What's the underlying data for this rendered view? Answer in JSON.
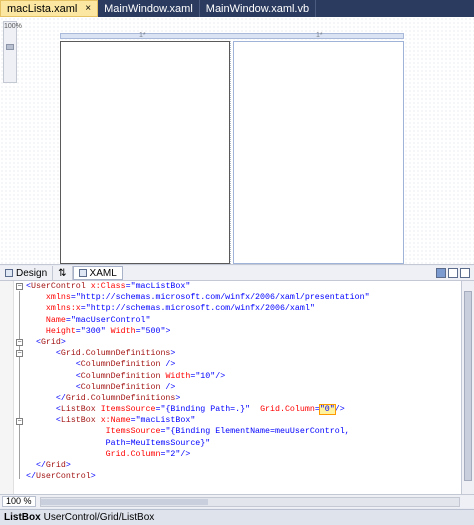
{
  "tabs": [
    {
      "label": "macLista.xaml",
      "active": true,
      "close": "×"
    },
    {
      "label": "MainWindow.xaml",
      "active": false
    },
    {
      "label": "MainWindow.xaml.vb",
      "active": false
    }
  ],
  "design": {
    "zoom_rail_label": "100%",
    "col_markers": {
      "top_left": "1*",
      "top_right": "1*"
    }
  },
  "split_tabs": {
    "design": "Design",
    "swap": "⇅",
    "xaml": "XAML"
  },
  "code_lines": [
    [
      "<",
      "UserControl",
      " ",
      "x:Class",
      "=",
      "\"macListBox\""
    ],
    [
      "    ",
      "xmlns",
      "=",
      "\"http://schemas.microsoft.com/winfx/2006/xaml/presentation\""
    ],
    [
      "    ",
      "xmlns:x",
      "=",
      "\"http://schemas.microsoft.com/winfx/2006/xaml\""
    ],
    [
      "    ",
      "Name",
      "=",
      "\"macUserControl\""
    ],
    [
      "    ",
      "Height",
      "=",
      "\"300\"",
      " ",
      "Width",
      "=",
      "\"500\"",
      ">"
    ],
    [
      "  <",
      "Grid",
      ">"
    ],
    [
      "      <",
      "Grid.ColumnDefinitions",
      ">"
    ],
    [
      "          <",
      "ColumnDefinition",
      " />"
    ],
    [
      "          <",
      "ColumnDefinition",
      " ",
      "Width",
      "=",
      "\"10\"",
      "/>"
    ],
    [
      "          <",
      "ColumnDefinition",
      " />"
    ],
    [
      "      </",
      "Grid.ColumnDefinitions",
      ">"
    ],
    [
      "      <",
      "ListBox",
      " ",
      "ItemsSource",
      "=",
      "\"{Binding Path=.}\"",
      "  ",
      "Grid.Column",
      "=",
      "\"0\"",
      "/>"
    ],
    [
      "      <",
      "ListBox",
      " ",
      "x:Name",
      "=",
      "\"macListBox\""
    ],
    [
      "                ",
      "ItemsSource",
      "=",
      "\"{Binding ElementName=meuUserControl,"
    ],
    [
      "                ",
      "Path=MeuItemsSource}\""
    ],
    [
      "                ",
      "Grid.Column",
      "=",
      "\"2\"",
      "/>"
    ],
    [
      "  </",
      "Grid",
      ">"
    ],
    [
      "</",
      "UserControl",
      ">"
    ]
  ],
  "zoom": {
    "value": "100 %"
  },
  "status": {
    "element": "ListBox",
    "path": "UserControl/Grid/ListBox"
  }
}
